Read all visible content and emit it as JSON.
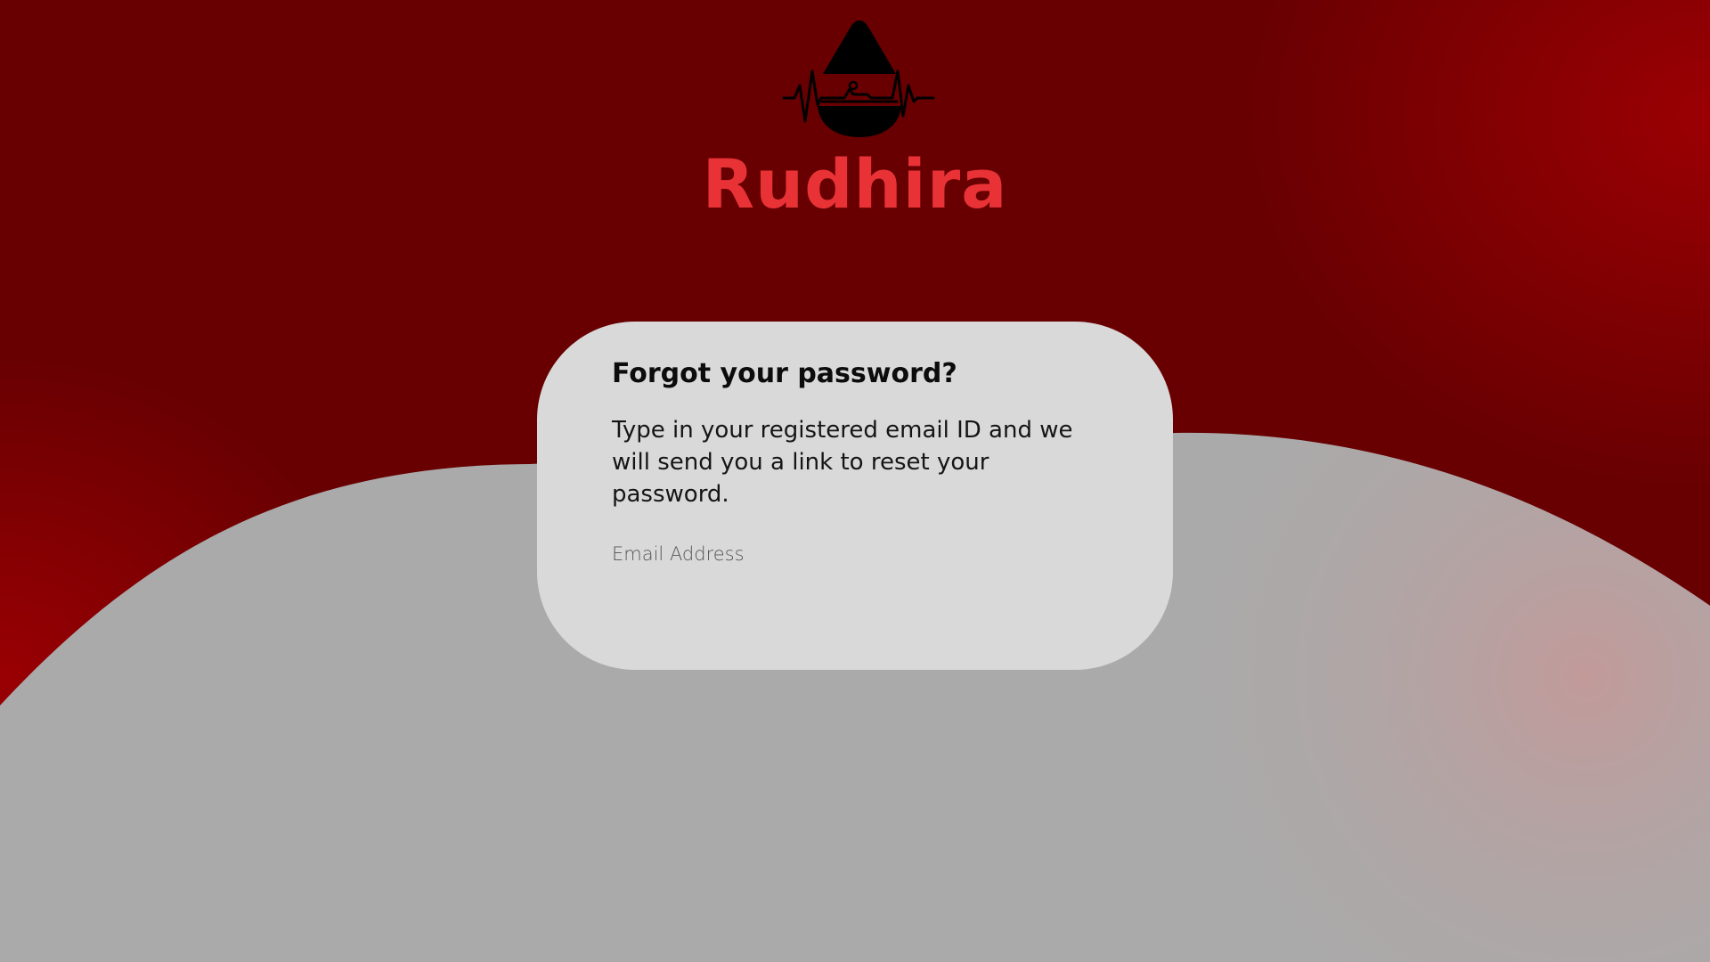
{
  "brand": {
    "name": "Rudhira",
    "logo_icon": "blood-drop-heartbeat-icon",
    "color": "#e83236"
  },
  "reset_card": {
    "title": "Forgot your password?",
    "description": "Type in your registered email ID and we will send you a link to reset your password.",
    "email_placeholder": "Email Address",
    "email_value": ""
  },
  "colors": {
    "background_dark_red": "#680002",
    "background_bright_red": "#9b0003",
    "wave_gray": "#aaaaaa",
    "card_gray": "#d9d9d9"
  }
}
